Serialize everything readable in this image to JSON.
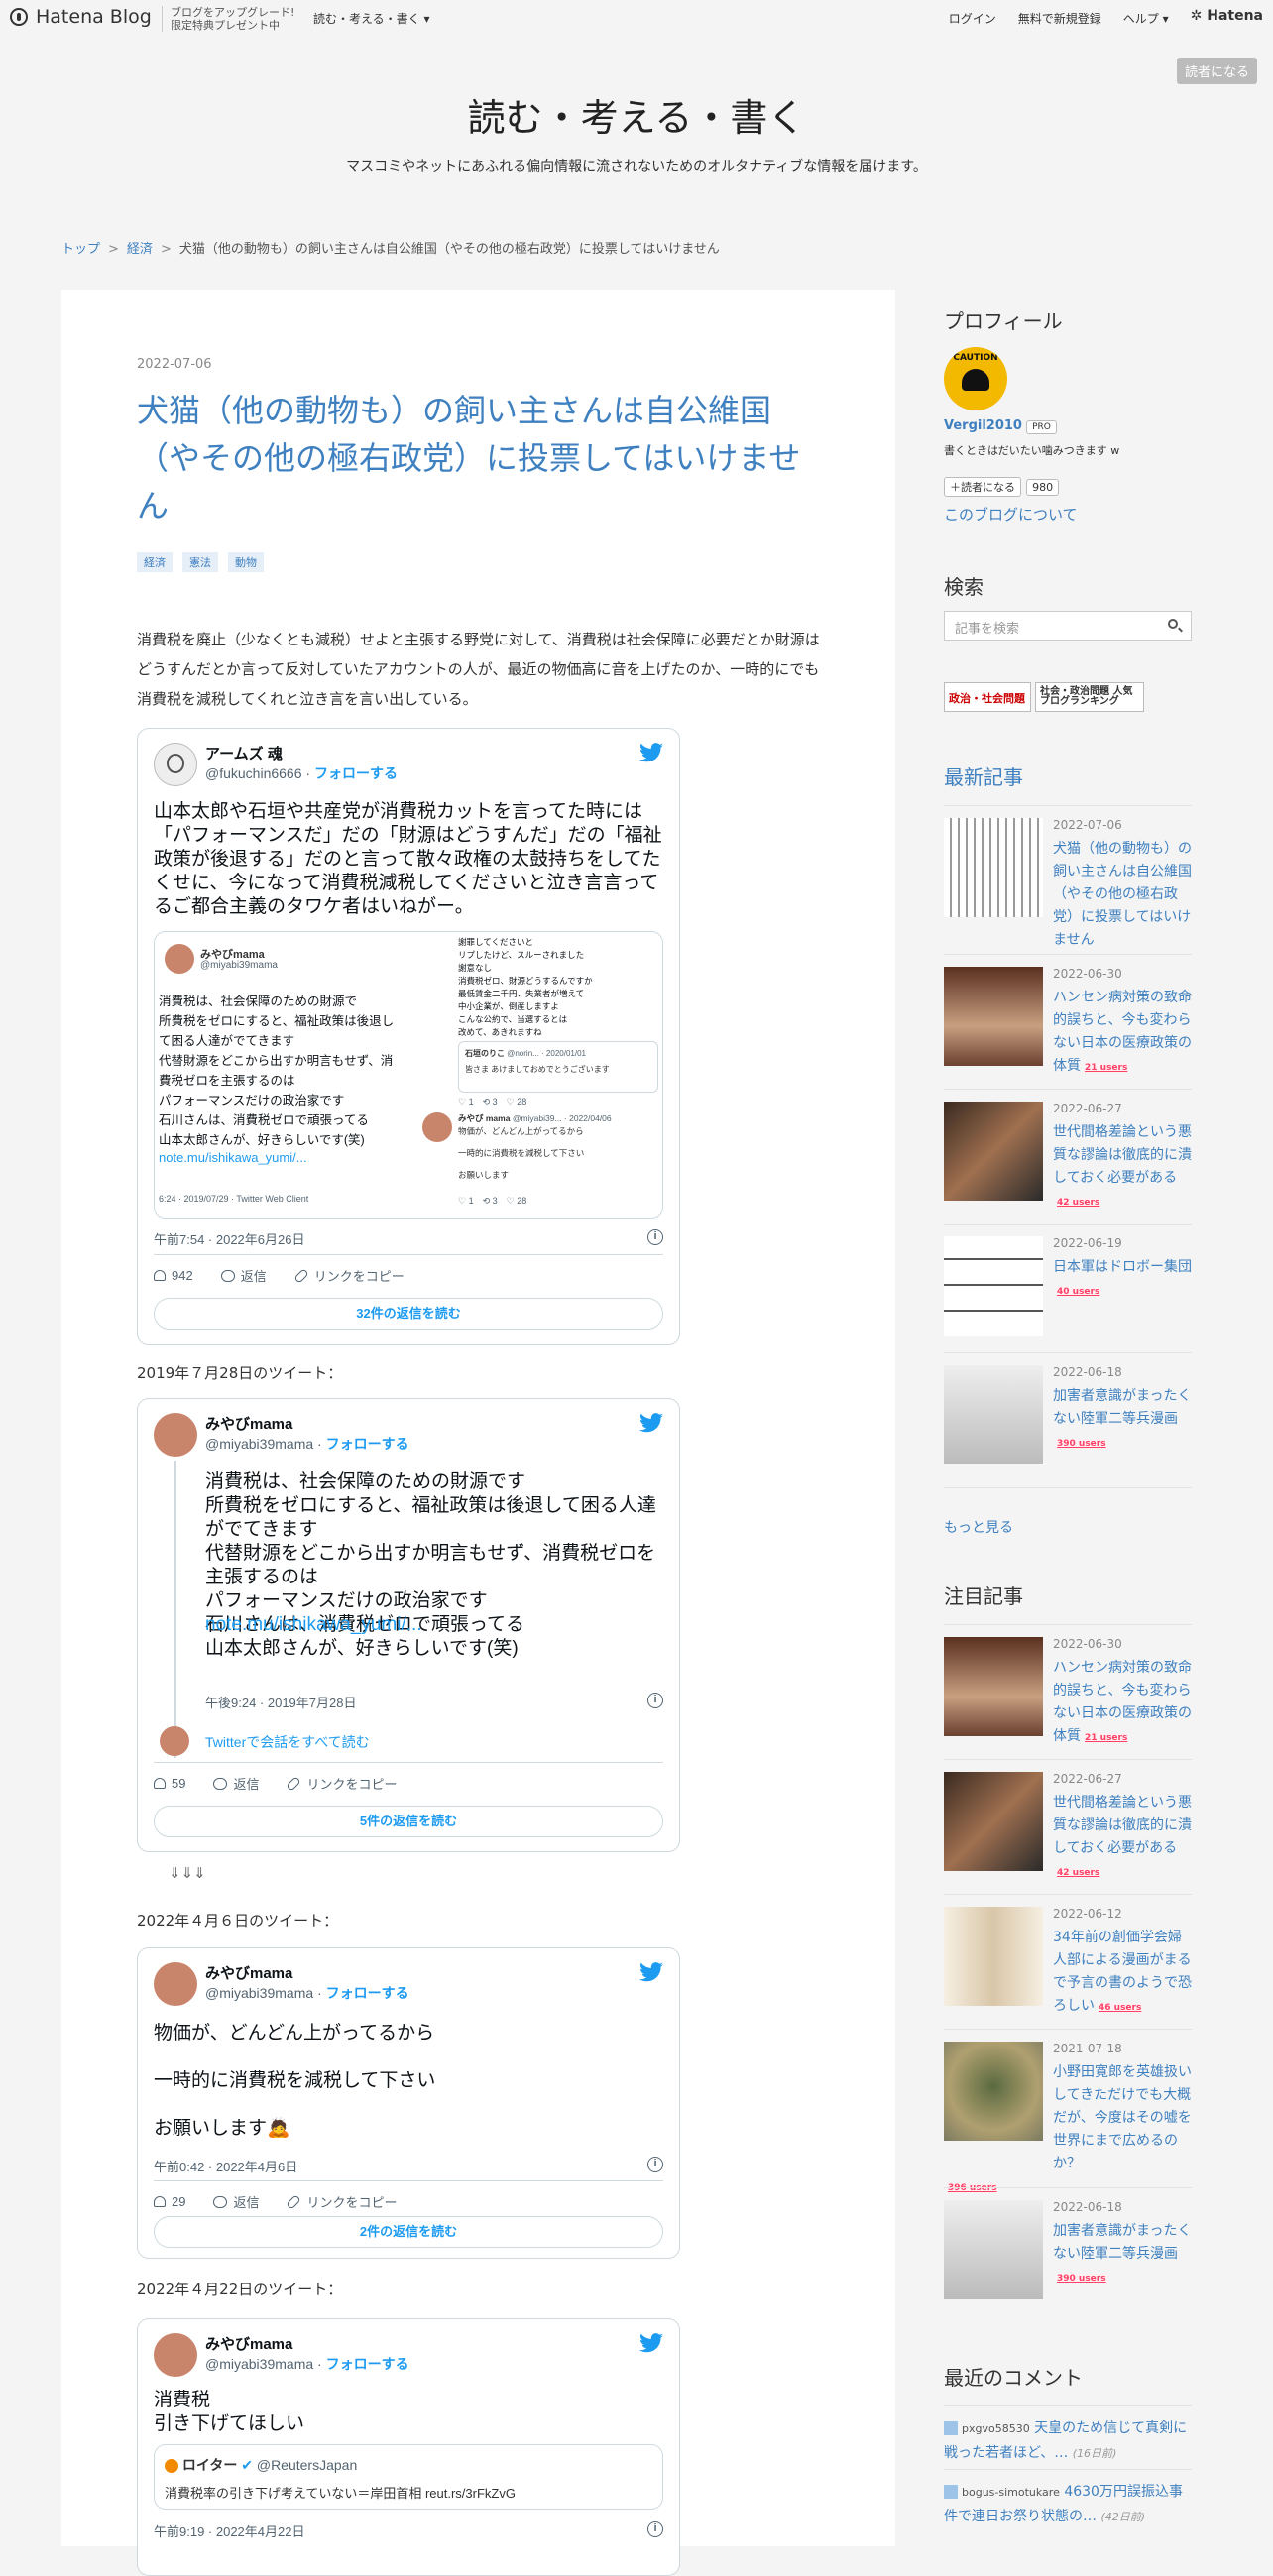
{
  "header": {
    "logo_text": "Hatena Blog",
    "promo_line1": "ブログをアップグレード!",
    "promo_line2": "限定特典プレゼント中",
    "blog_nav": "読む・考える・書く",
    "login": "ログイン",
    "register": "無料で新規登録",
    "help": "ヘルプ",
    "hatena": "Hatena",
    "subscribe": "読者になる"
  },
  "blog": {
    "title": "読む・考える・書く",
    "description": "マスコミやネットにあふれる偏向情報に流されないためのオルタナティブな情報を届けます。"
  },
  "breadcrumb": {
    "top": "トップ",
    "category": "経済",
    "current": "犬猫（他の動物も）の飼い主さんは自公維国（やその他の極右政党）に投票してはいけません"
  },
  "article": {
    "date": "2022-07-06",
    "title": "犬猫（他の動物も）の飼い主さんは自公維国（やその他の極右政党）に投票してはいけません",
    "tags": [
      "経済",
      "憲法",
      "動物"
    ],
    "intro": "消費税を廃止（少なくとも減税）せよと主張する野党に対して、消費税は社会保障に必要だとか財源はどうすんだとか言って反対していたアカウントの人が、最近の物価高に音を上げたのか、一時的にでも消費税を減税してくれと泣き言を言い出している。",
    "label_2019": "2019年７月28日のツイート：",
    "arrows": "⇓⇓⇓",
    "label_2022_04_06": "2022年４月６日のツイート：",
    "label_2022_04_22": "2022年４月22日のツイート："
  },
  "tweets": {
    "t1": {
      "name": "アームズ 魂",
      "handle": "@fukuchin6666",
      "follow": "フォローする",
      "text": "山本太郎や石垣や共産党が消費税カットを言ってた時には「パフォーマンスだ」だの「財源はどうすんだ」だの「福祉政策が後退する」だのと言って散々政権の太鼓持ちをしてたくせに、今になって消費税減税してくださいと泣き言言ってるご都合主義のタワケ者はいねがー。",
      "embed_name": "みやびmama",
      "embed_handle": "@miyabi39mama",
      "embed_text": "消費税は、社会保障のための財源で\n所費税をゼロにすると、福祉政策は後退して困る人達がでてきます\n代替財源をどこから出すか明言もせず、消費税ゼロを主張するのは\nパフォーマンスだけの政治家です\n石川さんは、消費税ゼロで頑張ってる\n山本太郎さんが、好きらしいです(笑)",
      "embed_link": "note.mu/ishikawa_yumi/...",
      "embed_meta": "6:24 · 2019/07/29 · Twitter Web Client",
      "embed_right_text": "謝罪してくださいと\nリプしたけど、スルーされました\n謝意なし\n消費税ゼロ、財源どうするんですか\n最低賃金二千円、失業者が増えて\n中小企業が、倒産しますよ\nこんな公約で、当選するとは\n改めて、あきれますね",
      "embed_quote_name": "石垣のりこ",
      "embed_quote_meta": "@norin... · 2020/01/01",
      "embed_quote_text": "皆さま あけましておめでとうございます",
      "embed_reply_name": "みやび mama",
      "embed_reply_meta": "@miyabi39... · 2022/04/06",
      "embed_reply_text": "物価が、どんどん上がってるから\n\n一時的に消費税を減税して下さい\n\nお願いします",
      "embed_counts": [
        "1",
        "3",
        "28"
      ],
      "time": "午前7:54 · 2022年6月26日",
      "likes": "942",
      "reply": "返信",
      "copy": "リンクをコピー",
      "replies_button": "32件の返信を読む"
    },
    "t2": {
      "name": "みやびmama",
      "handle": "@miyabi39mama",
      "follow": "フォローする",
      "text": "消費税は、社会保障のための財源です\n所費税をゼロにすると、福祉政策は後退して困る人達がでてきます\n代替財源をどこから出すか明言もせず、消費税ゼロを主張するのは\nパフォーマンスだけの政治家です\n石川さんは、消費税ゼロで頑張ってる\n山本太郎さんが、好きらしいです(笑)",
      "link": "note.mu/ishikawa_yumi/...",
      "time": "午後9:24 · 2019年7月28日",
      "thread_link": "Twitterで会話をすべて読む",
      "likes": "59",
      "reply": "返信",
      "copy": "リンクをコピー",
      "replies_button": "5件の返信を読む"
    },
    "t3": {
      "name": "みやびmama",
      "handle": "@miyabi39mama",
      "follow": "フォローする",
      "line1": "物価が、どんどん上がってるから",
      "line2": "一時的に消費税を減税して下さい",
      "line3": "お願いします🙇",
      "time": "午前0:42 · 2022年4月6日",
      "likes": "29",
      "reply": "返信",
      "copy": "リンクをコピー",
      "replies_button": "2件の返信を読む"
    },
    "t4": {
      "name": "みやびmama",
      "handle": "@miyabi39mama",
      "follow": "フォローする",
      "text": "消費税\n引き下げてほしい",
      "quote_name": "ロイター",
      "quote_handle": "@ReutersJapan",
      "quote_text": "消費税率の引き下げ考えていない＝岸田首相 reut.rs/3rFkZvG",
      "time": "午前9:19 · 2022年4月22日"
    }
  },
  "sidebar": {
    "profile_heading": "プロフィール",
    "profile_name": "Vergil2010",
    "pro_badge": "PRO",
    "profile_bio": "書くときはだいたい噛みつきます w",
    "subscribe_btn": "読者になる",
    "subscriber_count": "980",
    "about_link": "このブログについて",
    "search_heading": "検索",
    "search_placeholder": "記事を検索",
    "banner1": "政治・社会問題",
    "banner2": "社会・政治問題 人気ブログランキング",
    "latest_heading": "最新記事",
    "latest": [
      {
        "date": "2022-07-06",
        "title": "犬猫（他の動物も）の飼い主さんは自公維国（やその他の極右政党）に投票してはいけません",
        "users": ""
      },
      {
        "date": "2022-06-30",
        "title": "ハンセン病対策の致命的誤ちと、今も変わらない日本の医療政策の体質",
        "users": "21 users"
      },
      {
        "date": "2022-06-27",
        "title": "世代間格差論という悪質な謬論は徹底的に潰しておく必要がある",
        "users": "42 users"
      },
      {
        "date": "2022-06-19",
        "title": "日本軍はドロボー集団",
        "users": "40 users"
      },
      {
        "date": "2022-06-18",
        "title": "加害者意識がまったくない陸軍二等兵漫画",
        "users": "390 users"
      }
    ],
    "more_link": "もっと見る",
    "featured_heading": "注目記事",
    "featured": [
      {
        "date": "2022-06-30",
        "title": "ハンセン病対策の致命的誤ちと、今も変わらない日本の医療政策の体質",
        "users": "21 users"
      },
      {
        "date": "2022-06-27",
        "title": "世代間格差論という悪質な謬論は徹底的に潰しておく必要がある",
        "users": "42 users"
      },
      {
        "date": "2022-06-12",
        "title": "34年前の創価学会婦人部による漫画がまるで予言の書のようで恐ろしい",
        "users": "46 users"
      },
      {
        "date": "2021-07-18",
        "title": "小野田寛郎を英雄扱いしてきただけでも大概だが、今度はその嘘を世界にまで広めるのか？",
        "users": "396 users"
      },
      {
        "date": "2022-06-18",
        "title": "加害者意識がまったくない陸軍二等兵漫画",
        "users": "390 users"
      }
    ],
    "comments_heading": "最近のコメント",
    "comments": [
      {
        "user": "pxgvo58530",
        "text": "天皇のため信じて真剣に戦った若者ほど、…",
        "ago": "16日前"
      },
      {
        "user": "bogus-simotukare",
        "text": "4630万円誤振込事件で連日お祭り状態の…",
        "ago": "42日前"
      }
    ]
  },
  "colors": {
    "link": "#3f80c0",
    "twitter_blue": "#1d9bf0",
    "users_red": "#ff4166"
  }
}
